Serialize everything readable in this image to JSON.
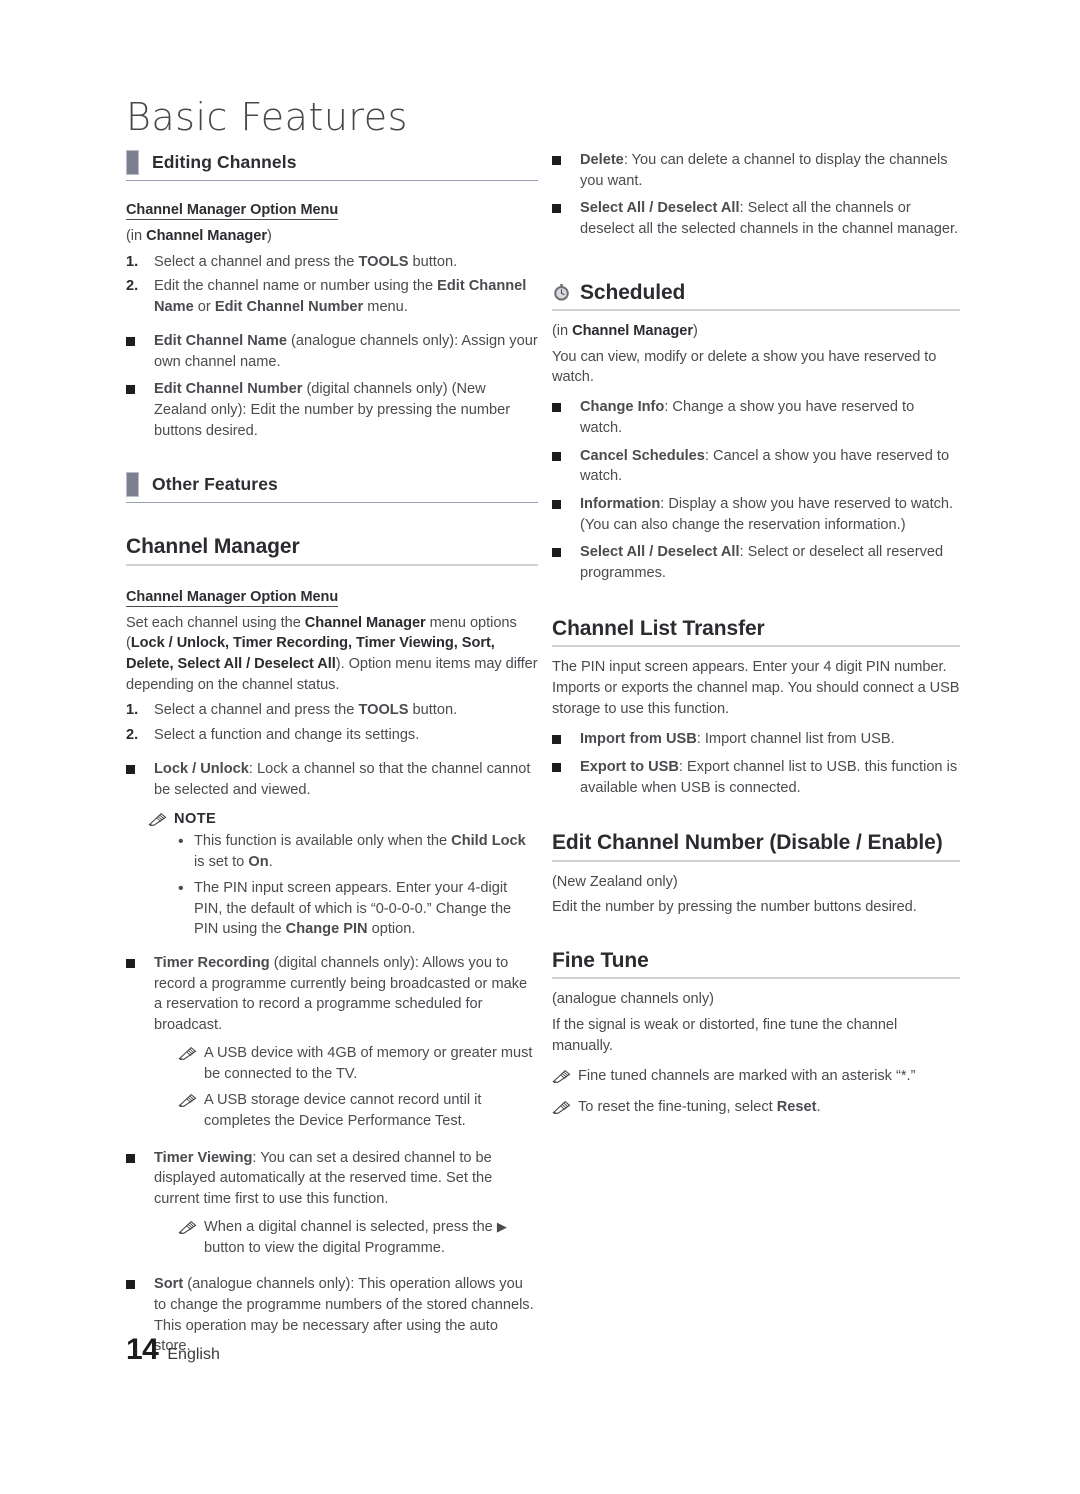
{
  "page": {
    "title": "Basic Features",
    "footer_page_number": "14",
    "footer_language": "English"
  },
  "left_column": {
    "section_editing_channels": {
      "heading": "Editing Channels",
      "sub_head": "Channel Manager Option Menu",
      "in_line_prefix": "(in ",
      "in_line_bold": "Channel Manager",
      "in_line_suffix": ")",
      "steps": [
        {
          "num": "1.",
          "text_a": "Select a channel and press the ",
          "bold": "TOOLS",
          "text_b": " button."
        },
        {
          "num": "2.",
          "text_a": "Edit the channel name or number using the ",
          "bold_a": "Edit Channel Name",
          "mid": " or ",
          "bold_b": "Edit Channel Number",
          "text_b": " menu."
        }
      ],
      "bullets": [
        {
          "bold": "Edit Channel Name",
          "text": " (analogue channels only): Assign your own channel name."
        },
        {
          "bold": "Edit Channel Number",
          "text": " (digital channels only) (New Zealand only): Edit the number by pressing the number buttons desired."
        }
      ]
    },
    "section_other_features": {
      "heading": "Other Features"
    },
    "section_channel_manager": {
      "heading": "Channel Manager",
      "sub_head": "Channel Manager Option Menu",
      "intro_a": "Set each channel using the ",
      "intro_bold_a": "Channel Manager",
      "intro_b": " menu options (",
      "intro_bold_b": "Lock / Unlock, Timer Recording, Timer Viewing, Sort, Delete, Select All / Deselect All",
      "intro_c": "). Option menu items may differ depending on the channel status.",
      "steps": [
        {
          "num": "1.",
          "text_a": "Select a channel and press the ",
          "bold": "TOOLS",
          "text_b": " button."
        },
        {
          "num": "2.",
          "text_a": "Select a function and change its settings.",
          "bold": "",
          "text_b": ""
        }
      ],
      "lock_unlock": {
        "bold": "Lock / Unlock",
        "text": ": Lock a channel so that the channel cannot be selected and viewed."
      },
      "note_label": "NOTE",
      "notes": [
        {
          "a": "This function is available only when the ",
          "b1": "Child Lock",
          "c": " is set to ",
          "b2": "On",
          "d": "."
        },
        {
          "a": "The PIN input screen appears. Enter your 4-digit PIN, the default of which is “0-0-0-0.” Change the PIN using the ",
          "b1": "Change PIN",
          "c": " option.",
          "b2": "",
          "d": ""
        }
      ],
      "timer_recording": {
        "bold": "Timer Recording",
        "text": " (digital channels only): Allows you to record a programme currently being broadcasted or make a reservation to record a programme scheduled for broadcast.",
        "subnotes": [
          "A USB device with 4GB of memory or greater must be connected to the TV.",
          "A USB storage device cannot record until it completes the Device Performance Test."
        ]
      },
      "timer_viewing": {
        "bold": "Timer Viewing",
        "text": ": You can set a desired channel to be displayed automatically at the reserved time. Set the current time first to use this function.",
        "subnote_a": "When a digital channel is selected, press the ",
        "subnote_arrow": "▶",
        "subnote_b": " button to view the digital Programme."
      },
      "sort": {
        "bold": "Sort",
        "text": " (analogue channels only): This operation allows you to change the programme numbers of the stored channels. This operation may be necessary after using the auto store."
      }
    }
  },
  "right_column": {
    "top_bullets": [
      {
        "bold": "Delete",
        "text": ": You can delete a channel to display the channels you want."
      },
      {
        "bold": "Select All / Deselect All",
        "text": ": Select all the channels or deselect all the selected channels in the channel manager."
      }
    ],
    "section_scheduled": {
      "heading": "Scheduled",
      "icon": "stopwatch-icon",
      "in_line_prefix": "(in ",
      "in_line_bold": "Channel Manager",
      "in_line_suffix": ")",
      "intro": "You can view, modify or delete a show you have reserved to watch.",
      "bullets": [
        {
          "bold": "Change Info",
          "text": ": Change a show you have reserved to watch."
        },
        {
          "bold": "Cancel Schedules",
          "text": ": Cancel a show you have reserved to watch."
        },
        {
          "bold": "Information",
          "text": ": Display a show you have reserved to watch. (You can also change the reservation information.)"
        },
        {
          "bold": "Select All / Deselect All",
          "text": ": Select or deselect all reserved programmes."
        }
      ]
    },
    "section_channel_list_transfer": {
      "heading": "Channel List Transfer",
      "intro": "The PIN input screen appears. Enter your 4 digit PIN number. Imports or exports the channel map. You should connect a USB storage to use this function.",
      "bullets": [
        {
          "bold": "Import from USB",
          "text": ": Import channel list from USB."
        },
        {
          "bold": "Export to USB",
          "text": ": Export channel list to USB. this function is available when USB is connected."
        }
      ]
    },
    "section_edit_channel_number": {
      "heading": "Edit Channel Number (Disable / Enable)",
      "region": "(New Zealand only)",
      "intro": "Edit the number by pressing the number buttons desired."
    },
    "section_fine_tune": {
      "heading": "Fine Tune",
      "region": "(analogue channels only)",
      "intro": "If the signal is weak or distorted, fine tune the channel manually.",
      "note_1": "Fine tuned channels are marked with an asterisk “*.”",
      "note_2_a": "To reset the fine-tuning, select ",
      "note_2_bold": "Reset",
      "note_2_b": "."
    }
  },
  "colors": {
    "section_bar": "#7c7f8d",
    "rule": "#d2d2d4",
    "body_text": "#4b4b50",
    "bold_text": "#2b2b30"
  }
}
